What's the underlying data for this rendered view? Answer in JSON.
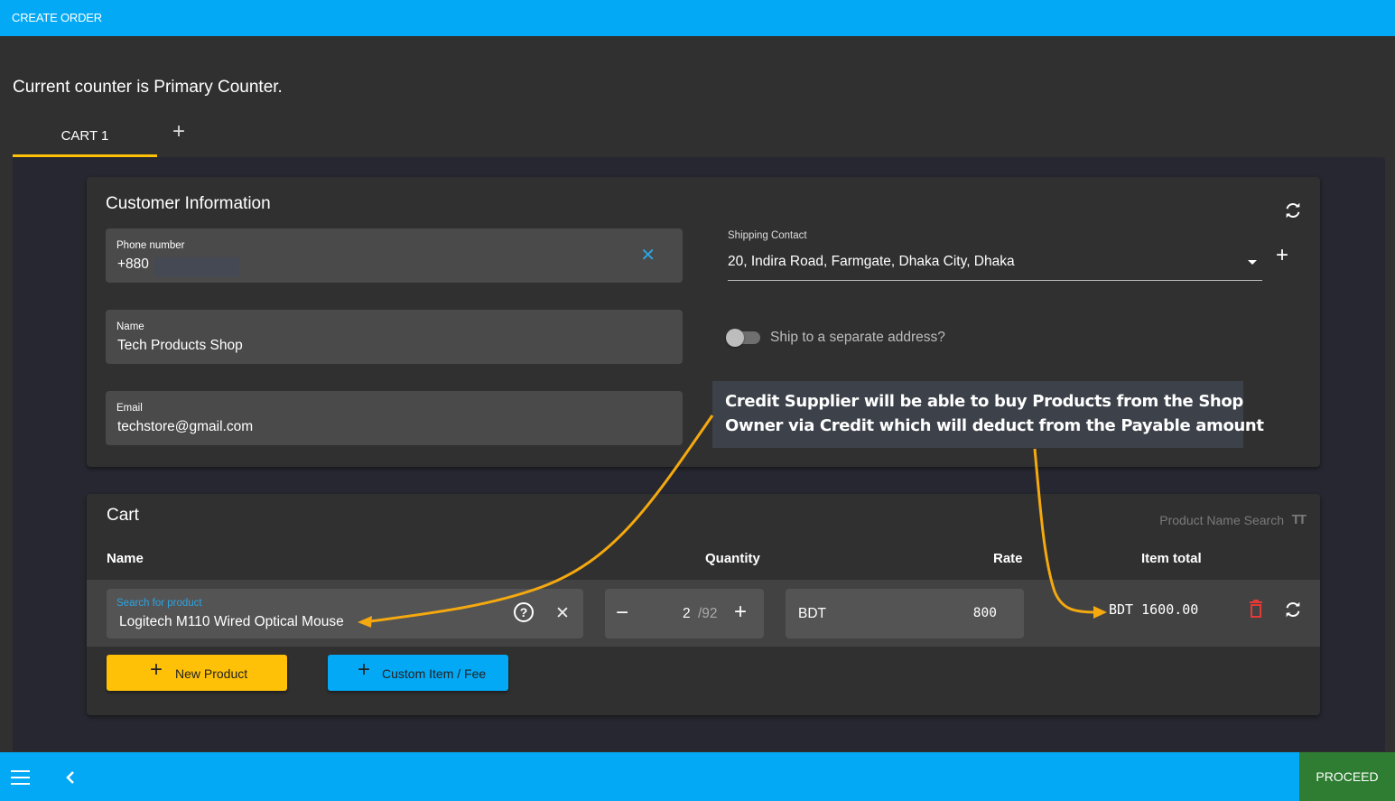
{
  "header": {
    "title": "CREATE ORDER"
  },
  "counter_text": "Current counter is Primary Counter.",
  "tabs": [
    {
      "label": "CART 1",
      "active": true
    }
  ],
  "tab_add_icon": "+",
  "customer": {
    "title": "Customer Information",
    "phone": {
      "label": "Phone number",
      "value": "+880"
    },
    "name": {
      "label": "Name",
      "value": "Tech Products Shop"
    },
    "email": {
      "label": "Email",
      "value": "techstore@gmail.com"
    },
    "shipping": {
      "label": "Shipping Contact",
      "value": "20, Indira Road, Farmgate, Dhaka City, Dhaka"
    },
    "separate_address": {
      "label": "Ship to a separate address?",
      "checked": false
    }
  },
  "callout": {
    "line1": "Credit Supplier will be able to buy Products from the Shop",
    "line2": "Owner via Credit which will deduct from the Payable amount"
  },
  "cart": {
    "title": "Cart",
    "search_mode": "Product Name Search",
    "columns": {
      "name": "Name",
      "quantity": "Quantity",
      "rate": "Rate",
      "item_total": "Item total"
    },
    "items": [
      {
        "search_label": "Search for product",
        "product": "Logitech M110 Wired Optical Mouse",
        "quantity": "2",
        "stock": "/92",
        "currency": "BDT",
        "rate": "800",
        "item_total": "BDT 1600.00"
      }
    ],
    "buttons": {
      "new_product": "New Product",
      "custom_item": "Custom Item / Fee"
    }
  },
  "footer": {
    "proceed": "PROCEED"
  },
  "colors": {
    "primary": "#03a9f4",
    "accent": "#ffc107",
    "success": "#2e7d32",
    "danger": "#e53935",
    "annotation": "#f5a90f"
  }
}
